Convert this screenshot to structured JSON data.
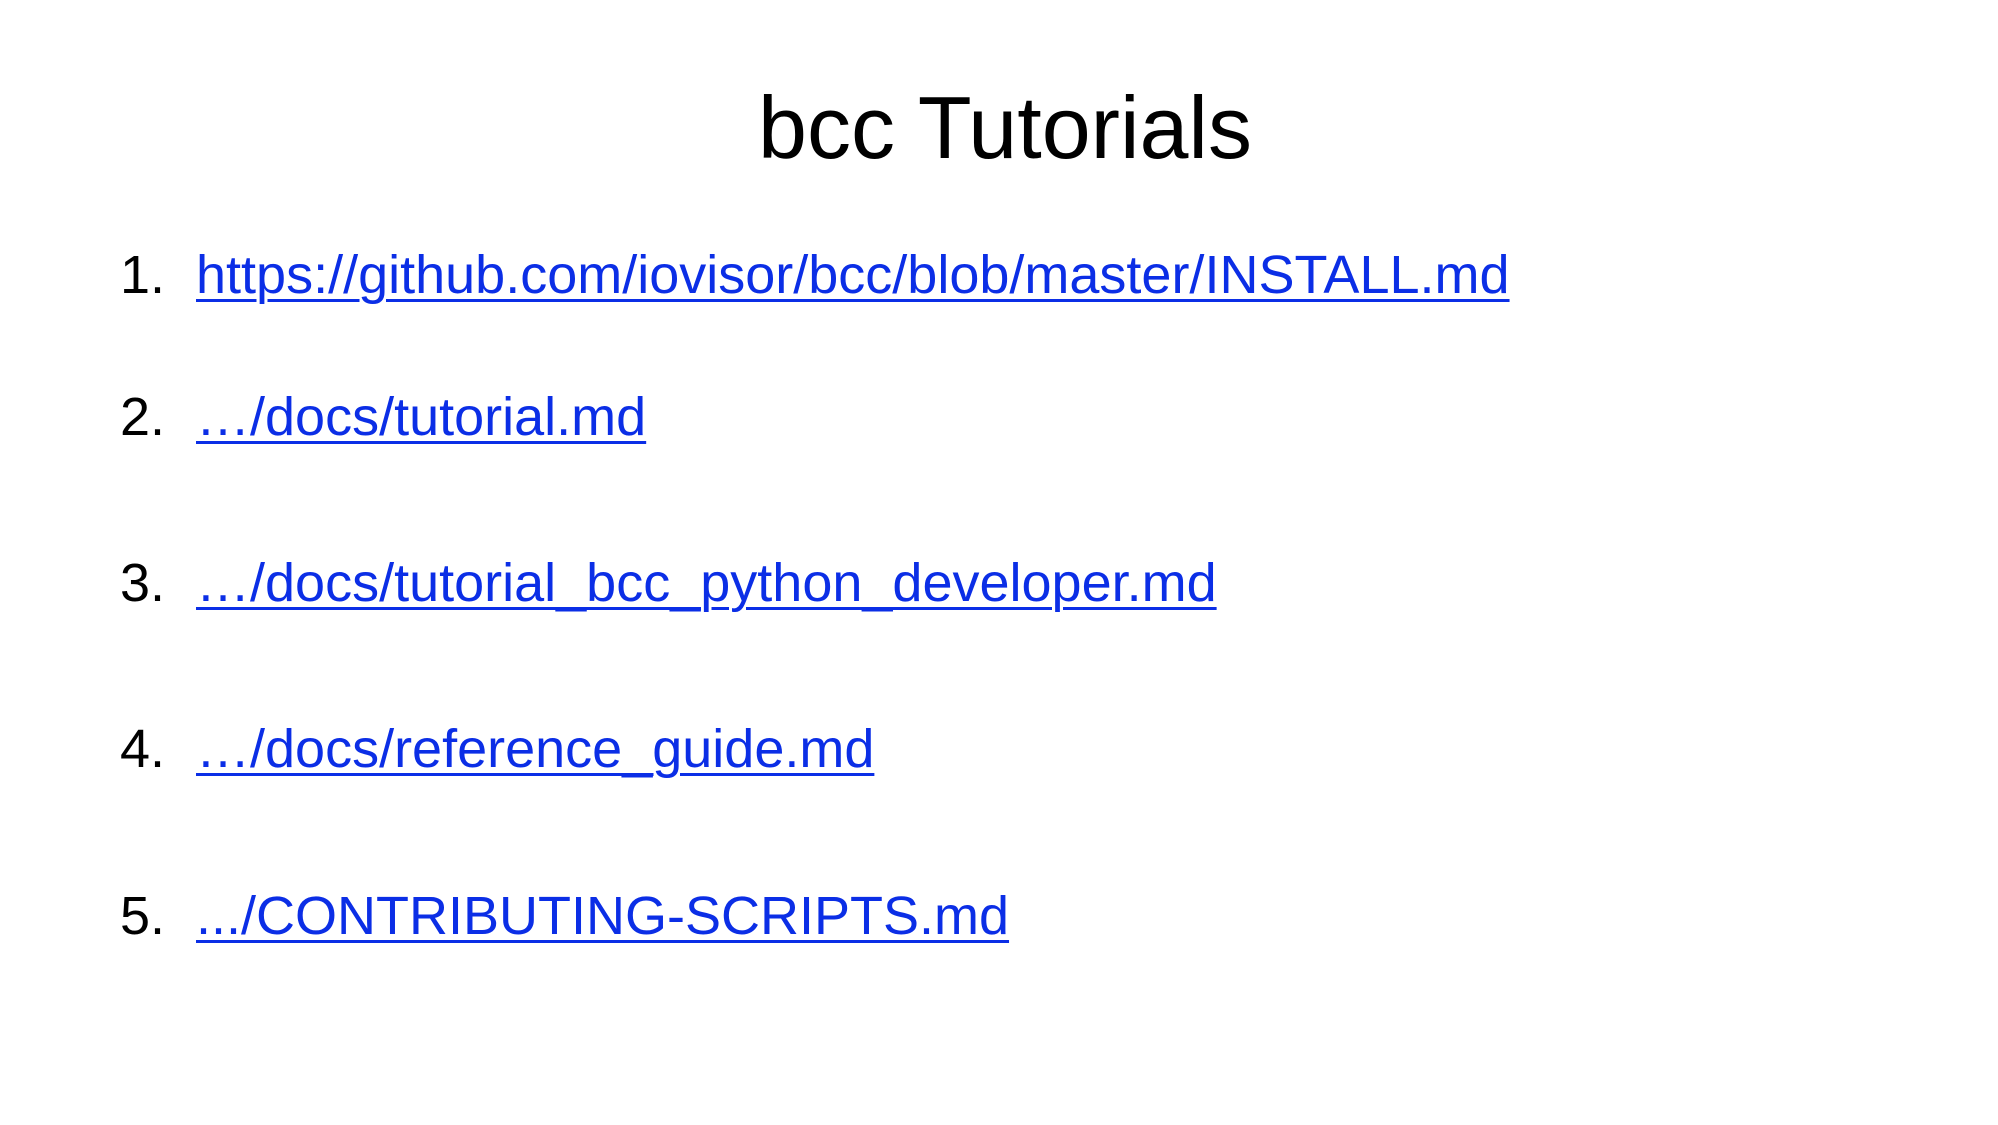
{
  "slide": {
    "title": "bcc Tutorials",
    "link_color": "#0b2ee6",
    "items": [
      {
        "number": "1.",
        "label": "https://github.com/iovisor/bcc/blob/master/INSTALL.md"
      },
      {
        "number": "2.",
        "label": "…/docs/tutorial.md"
      },
      {
        "number": "3.",
        "label": "…/docs/tutorial_bcc_python_developer.md"
      },
      {
        "number": "4.",
        "label": "…/docs/reference_guide.md"
      },
      {
        "number": "5.",
        "label": ".../CONTRIBUTING-SCRIPTS.md"
      }
    ]
  }
}
